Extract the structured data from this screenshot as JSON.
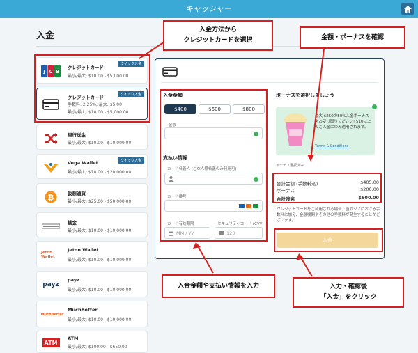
{
  "header": {
    "title": "キャッシャー",
    "home_icon": "home-icon"
  },
  "page": {
    "title": "入金"
  },
  "methods": [
    {
      "name": "クレジットカード",
      "lines": [
        "最小/最大: $10.00 - $5,000.00"
      ],
      "badge": "クイック入金",
      "logo": "JCB"
    },
    {
      "name": "クレジットカード",
      "lines": [
        "手数料: 2.25%, 最大: $5.00",
        "最小/最大: $10.00 - $5,000.00"
      ],
      "badge": "クイック入金",
      "logo": "card-icon"
    },
    {
      "name": "銀行送金",
      "lines": [
        "最小/最大: $10.00 - $10,000.00"
      ],
      "logo": "shuffle-icon"
    },
    {
      "name": "Vega Wallet",
      "lines": [
        "最小/最大: $10.00 - $20,000.00"
      ],
      "badge": "クイック入金",
      "logo": "vega-icon"
    },
    {
      "name": "仮想通貨",
      "lines": [
        "最小/最大: $25.00 - $50,000.00"
      ],
      "logo": "bitcoin-icon"
    },
    {
      "name": "Jeton Wallet",
      "lines": [
        "最小/最大: $10.00 - $10,000.00"
      ],
      "logo": "Jeton Wallet"
    },
    {
      "name": "payz",
      "lines": [
        "最小/最大: $10.00 - $10,000.00"
      ],
      "logo": "payz"
    },
    {
      "name": "MuchBetter",
      "lines": [
        "最小/最大: $10.00 - $10,000.00"
      ],
      "logo": "MuchBetter"
    },
    {
      "name": "ATM",
      "lines": [
        "最小/最大: $100.00 - $650.00"
      ],
      "logo": "ATM"
    }
  ],
  "form": {
    "amount_title": "入金金額",
    "amounts": [
      "$400",
      "$600",
      "$800"
    ],
    "amount_label": "金額",
    "payment_title": "支払い情報",
    "name_label": "カード名義人 (ご本人様名義のみ利用可)",
    "card_number_label": "カード番号",
    "expiry_label": "カード有効期限",
    "expiry_placeholder": "MM / YY",
    "cvv_label": "セキュリティコード (CVV)",
    "cvv_placeholder": "123"
  },
  "bonus": {
    "title": "ボーナスを選択しましょう",
    "promo_text": "最大 $250の50%入金ボーナスをお受け取りください! $10以上のご入金にのみ適用されます。",
    "terms": "Terms & Conditions",
    "selected_label": "ボーナス選択済み"
  },
  "summary": {
    "total_label": "合計金額 (手数料込)",
    "total_value": "$405.00",
    "bonus_label": "ボーナス",
    "bonus_value": "$200.00",
    "balance_label": "合計残高",
    "balance_value": "$600.00"
  },
  "note": "クレジットカードをご利用される場合、当カジノにおける手数料に加え、金融機関やその他の手数料が発生することがございます。",
  "deposit_button": "入金",
  "annotations": {
    "a1": "入金方法から\nクレジットカードを選択",
    "a2": "金額・ボーナスを確認",
    "a3": "入金金額や支払い情報を入力",
    "a4": "入力・確認後\n「入金」をクリック"
  },
  "colors": {
    "topbar": "#3aa9d6",
    "annotation": "#d62020",
    "deposit": "#f4d79a",
    "dark": "#1e3850"
  }
}
